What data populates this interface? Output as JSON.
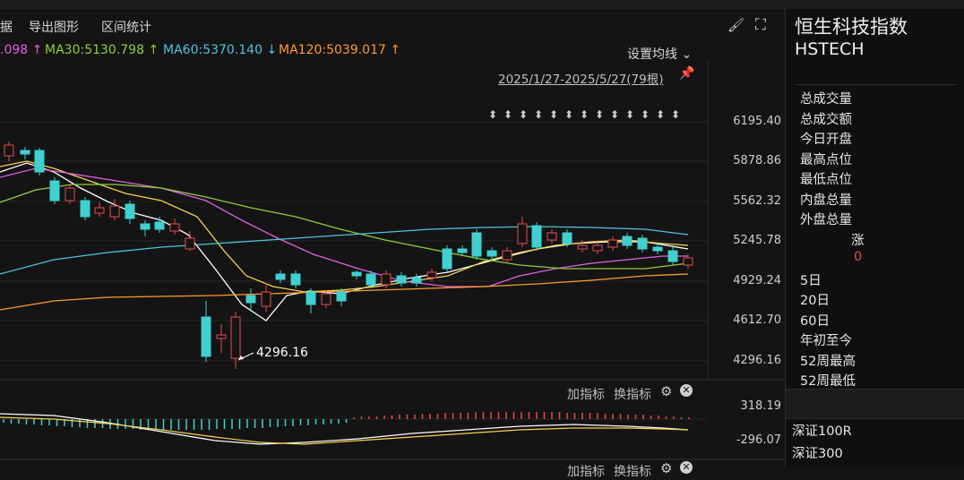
{
  "toolbar": {
    "item_data": "据",
    "export_chart": "导出图形",
    "range_stats": "区间统计"
  },
  "ma_legend": {
    "ma20_partial": ".098",
    "ma20_arrow": "↑",
    "ma30": "MA30:5130.798",
    "ma30_arrow": "↑",
    "ma60": "MA60:5370.140",
    "ma60_arrow": "↓",
    "ma120": "MA120:5039.017",
    "ma120_arrow": "↑",
    "set_ma": "设置均线",
    "set_ma_chevron": "⌄"
  },
  "date_range": "2025/1/27-2025/5/27(79根)",
  "price_axis": [
    "6195.40",
    "5878.86",
    "5562.32",
    "5245.78",
    "4929.24",
    "4612.70",
    "4296.16"
  ],
  "low_marker": "4296.16",
  "indicator": {
    "add": "加指标",
    "switch": "换指标",
    "max": "318.19",
    "min": "-296.07"
  },
  "sidebar": {
    "title": "恒生科技指数",
    "code": "HSTECH",
    "fields": [
      "总成交量",
      "总成交额",
      "今日开盘",
      "最高点位",
      "最低点位",
      "内盘总量",
      "外盘总量"
    ],
    "rise_label": "涨",
    "rise_value": "0",
    "periods": [
      "5日",
      "20日",
      "60日",
      "年初至今",
      "52周最高",
      "52周最低"
    ],
    "related": [
      "深证100R",
      "深证300"
    ]
  },
  "colors": {
    "up": "#e84b4b",
    "down": "#40d0d0",
    "ma5": "#ffffff",
    "ma10": "#f5d44a",
    "ma20": "#e15fe1",
    "ma30": "#8bd13a",
    "ma60": "#4fc3d9",
    "ma120": "#ff9b2f"
  }
}
